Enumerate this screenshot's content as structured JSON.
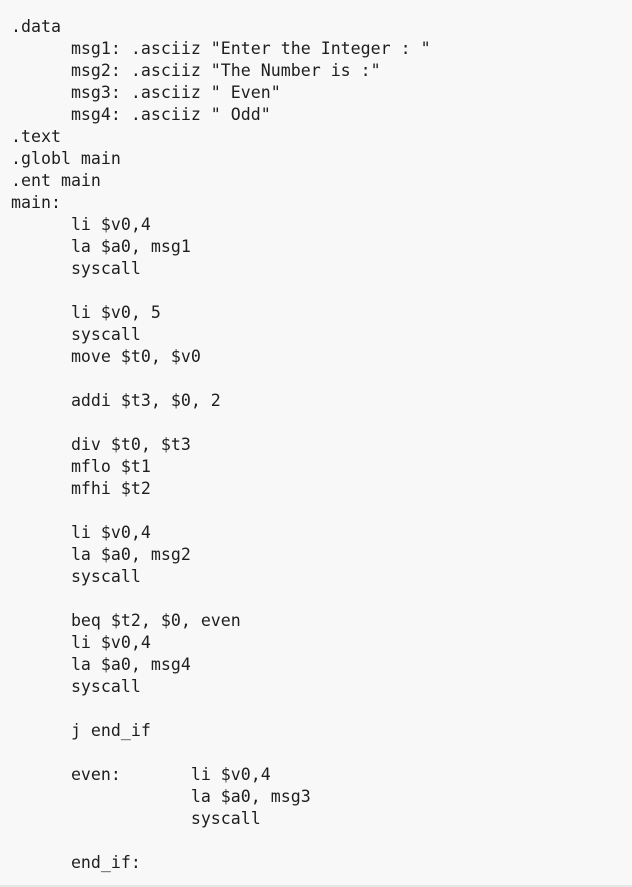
{
  "code": {
    "lines": [
      ".data",
      "      msg1: .asciiz \"Enter the Integer : \"",
      "      msg2: .asciiz \"The Number is :\"",
      "      msg3: .asciiz \" Even\"",
      "      msg4: .asciiz \" Odd\"",
      ".text",
      ".globl main",
      ".ent main",
      "main:",
      "      li $v0,4",
      "      la $a0, msg1",
      "      syscall",
      "",
      "      li $v0, 5",
      "      syscall",
      "      move $t0, $v0",
      "",
      "      addi $t3, $0, 2",
      "",
      "      div $t0, $t3",
      "      mflo $t1",
      "      mfhi $t2",
      "",
      "      li $v0,4",
      "      la $a0, msg2",
      "      syscall",
      "",
      "      beq $t2, $0, even",
      "      li $v0,4",
      "      la $a0, msg4",
      "      syscall",
      "",
      "      j end_if",
      "",
      "      even:       li $v0,4",
      "                  la $a0, msg3",
      "                  syscall",
      "",
      "      end_if:"
    ]
  }
}
